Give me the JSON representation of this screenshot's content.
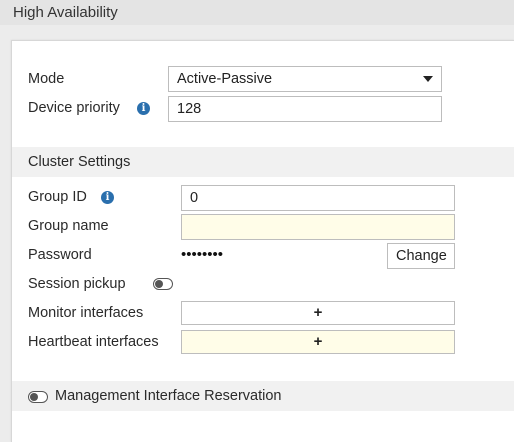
{
  "header": {
    "title": "High Availability"
  },
  "form": {
    "mode_label": "Mode",
    "mode_value": "Active-Passive",
    "priority_label": "Device priority",
    "priority_value": "128"
  },
  "cluster": {
    "section_title": "Cluster Settings",
    "group_id_label": "Group ID",
    "group_id_value": "0",
    "group_name_label": "Group name",
    "group_name_value": "",
    "password_label": "Password",
    "password_mask": "••••••••",
    "change_button": "Change",
    "session_pickup_label": "Session pickup",
    "session_pickup_enabled": false,
    "monitor_label": "Monitor interfaces",
    "heartbeat_label": "Heartbeat interfaces",
    "add_symbol": "+"
  },
  "management": {
    "label": "Management Interface Reservation",
    "enabled": false
  },
  "icons": {
    "info": "info-icon",
    "caret": "caret-down-icon",
    "toggle": "toggle-off-icon"
  },
  "colors": {
    "accent": "#2a6fad",
    "required_field_bg": "#fffde8"
  }
}
